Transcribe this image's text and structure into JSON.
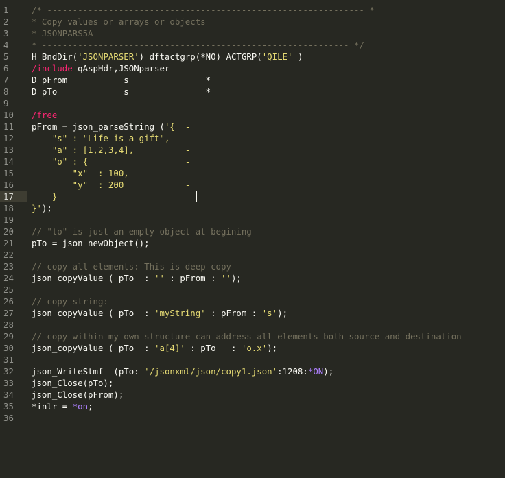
{
  "editor": {
    "line_numbers": [
      "1",
      "2",
      "3",
      "4",
      "5",
      "6",
      "7",
      "8",
      "9",
      "10",
      "11",
      "12",
      "13",
      "14",
      "15",
      "16",
      "17",
      "18",
      "19",
      "20",
      "21",
      "22",
      "23",
      "24",
      "25",
      "26",
      "27",
      "28",
      "29",
      "30",
      "31",
      "32",
      "33",
      "34",
      "35",
      "36"
    ],
    "active_line": 17,
    "colors": {
      "background": "#272822",
      "comment": "#75715e",
      "string": "#e6db74",
      "keyword": "#f92672",
      "constant": "#ae81ff",
      "text": "#f8f8f2"
    },
    "lines": [
      [
        {
          "t": "c",
          "v": "/* -------------------------------------------------------------- *"
        }
      ],
      [
        {
          "t": "c",
          "v": "* Copy values or arrays or objects"
        }
      ],
      [
        {
          "t": "c",
          "v": "* JSONPARS5A"
        }
      ],
      [
        {
          "t": "c",
          "v": "* ------------------------------------------------------------ */"
        }
      ],
      [
        {
          "t": "p",
          "v": "H BndDir("
        },
        {
          "t": "s",
          "v": "'JSONPARSER'"
        },
        {
          "t": "p",
          "v": ") dftactgrp(*NO) ACTGRP("
        },
        {
          "t": "s",
          "v": "'QILE'"
        },
        {
          "t": "p",
          "v": " )"
        }
      ],
      [
        {
          "t": "k",
          "v": "/include"
        },
        {
          "t": "p",
          "v": " qAspHdr,JSONparser"
        }
      ],
      [
        {
          "t": "p",
          "v": "D pFrom           s               *"
        }
      ],
      [
        {
          "t": "p",
          "v": "D pTo             s               *"
        }
      ],
      [],
      [
        {
          "t": "k",
          "v": "/free"
        }
      ],
      [
        {
          "t": "p",
          "v": "pFrom = json_parseString ("
        },
        {
          "t": "s",
          "v": "'{  -"
        }
      ],
      [
        {
          "t": "s",
          "v": "    \"s\" : \"Life is a gift\",   -"
        }
      ],
      [
        {
          "t": "s",
          "v": "    \"a\" : [1,2,3,4],          -"
        }
      ],
      [
        {
          "t": "s",
          "v": "    \"o\" : {                   -"
        }
      ],
      [
        {
          "t": "s",
          "v": "        \"x\"  : 100,           -"
        }
      ],
      [
        {
          "t": "s",
          "v": "        \"y\"  : 200            -"
        }
      ],
      [
        {
          "t": "s",
          "v": "    }"
        }
      ],
      [
        {
          "t": "s",
          "v": "}'"
        },
        {
          "t": "p",
          "v": ");"
        }
      ],
      [],
      [
        {
          "t": "c",
          "v": "// \"to\" is just an empty object at begining"
        }
      ],
      [
        {
          "t": "p",
          "v": "pTo = json_newObject();"
        }
      ],
      [],
      [
        {
          "t": "c",
          "v": "// copy all elements: This is deep copy"
        }
      ],
      [
        {
          "t": "p",
          "v": "json_copyValue ( pTo  : "
        },
        {
          "t": "s",
          "v": "''"
        },
        {
          "t": "p",
          "v": " : pFrom : "
        },
        {
          "t": "s",
          "v": "''"
        },
        {
          "t": "p",
          "v": ");"
        }
      ],
      [],
      [
        {
          "t": "c",
          "v": "// copy string:"
        }
      ],
      [
        {
          "t": "p",
          "v": "json_copyValue ( pTo  : "
        },
        {
          "t": "s",
          "v": "'myString'"
        },
        {
          "t": "p",
          "v": " : pFrom : "
        },
        {
          "t": "s",
          "v": "'s'"
        },
        {
          "t": "p",
          "v": ");"
        }
      ],
      [],
      [
        {
          "t": "c",
          "v": "// copy within my own structure can address all elements both source and destination"
        }
      ],
      [
        {
          "t": "p",
          "v": "json_copyValue ( pTo  : "
        },
        {
          "t": "s",
          "v": "'a[4]'"
        },
        {
          "t": "p",
          "v": " : pTo   : "
        },
        {
          "t": "s",
          "v": "'o.x'"
        },
        {
          "t": "p",
          "v": ");"
        }
      ],
      [],
      [
        {
          "t": "p",
          "v": "json_WriteStmf  (pTo: "
        },
        {
          "t": "s",
          "v": "'/jsonxml/json/copy1.json'"
        },
        {
          "t": "p",
          "v": ":1208:"
        },
        {
          "t": "n",
          "v": "*ON"
        },
        {
          "t": "p",
          "v": ");"
        }
      ],
      [
        {
          "t": "p",
          "v": "json_Close(pTo);"
        }
      ],
      [
        {
          "t": "p",
          "v": "json_Close(pFrom);"
        }
      ],
      [
        {
          "t": "p",
          "v": "*inlr = "
        },
        {
          "t": "n",
          "v": "*on"
        },
        {
          "t": "p",
          "v": ";"
        }
      ],
      []
    ]
  }
}
